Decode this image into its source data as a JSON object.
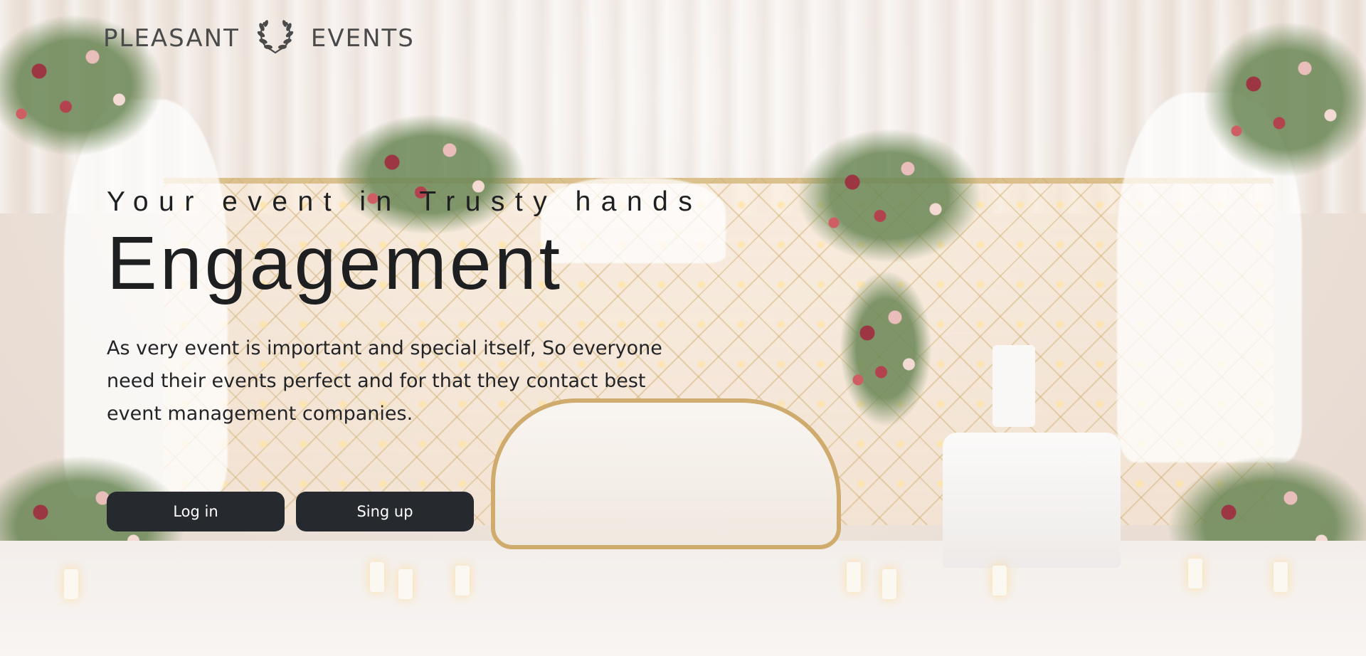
{
  "brand": {
    "left_word": "PLEASANT",
    "right_word": "EVENTS",
    "emblem": "laurel-wreath-icon"
  },
  "hero": {
    "tagline": "Your event in Trusty hands",
    "headline": "Engagement",
    "description": "As very event is important and special itself, So everyone need their events perfect and for that they contact best event management companies.",
    "background": "engagement-stage-photo"
  },
  "buttons": {
    "login_label": "Log in",
    "signup_label": "Sing up"
  },
  "colors": {
    "button_bg": "#262a2f",
    "button_text": "#ffffff",
    "brand_text": "#4a4a4a",
    "headline_text": "#1e1f21"
  }
}
